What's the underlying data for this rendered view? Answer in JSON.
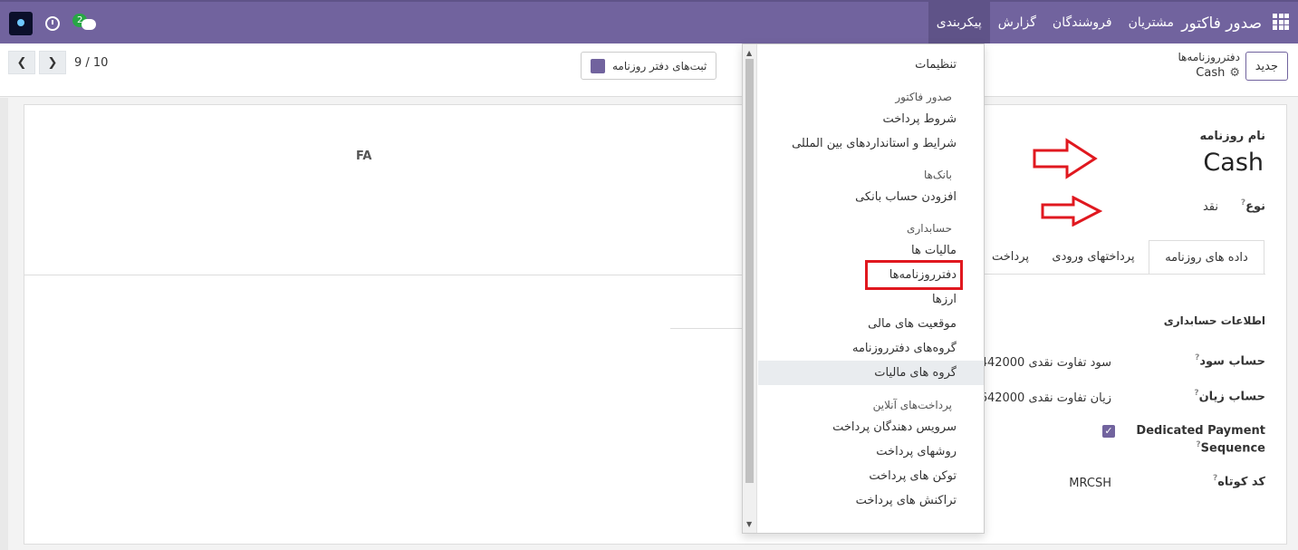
{
  "navbar": {
    "brand": "صدور فاکتور",
    "menu": [
      "مشتریان",
      "فروشندگان",
      "گزارش",
      "پیکربندی"
    ],
    "active_menu": "پیکربندی",
    "chat_badge": "2",
    "color": "#71639e"
  },
  "control": {
    "new_button": "جدید",
    "breadcrumb_parent": "دفترروزنامه‌ها",
    "breadcrumb_current": "Cash",
    "entries_button": "ثبت‌های دفتر روزنامه",
    "pager": "9 / 10"
  },
  "sheet": {
    "fa_text": "FA",
    "journal_name_label": "نام روزنامه",
    "journal_name": "Cash",
    "type_label": "نوع",
    "type_value": "نقد",
    "tabs": [
      "داده های روزنامه",
      "پرداختهای ورودی",
      "پرداخت"
    ],
    "section_title": "اطلاعات حسابداری",
    "profit_label": "حساب سود",
    "profit_value": "442000 سود تفاوت نقدی",
    "loss_label": "حساب زیان",
    "loss_value": "642000 زیان تفاوت نقدی",
    "dedicated_label_1": "Dedicated Payment",
    "dedicated_label_2": "Sequence",
    "dedicated_checked": true,
    "short_code_label": "کد کوتاه",
    "short_code_value": "MRCSH",
    "help_mark": "?"
  },
  "dropdown": {
    "items": [
      {
        "kind": "item",
        "label": "تنظیمات"
      },
      {
        "kind": "header",
        "label": "صدور فاکتور"
      },
      {
        "kind": "item",
        "label": "شروط پرداخت"
      },
      {
        "kind": "item",
        "label": "شرایط و استانداردهای بین المللی"
      },
      {
        "kind": "header",
        "label": "بانک‌ها"
      },
      {
        "kind": "item",
        "label": "افزودن حساب بانکی"
      },
      {
        "kind": "header",
        "label": "حسابداری"
      },
      {
        "kind": "item",
        "label": "مالیات ها"
      },
      {
        "kind": "item",
        "label": "دفترروزنامه‌ها"
      },
      {
        "kind": "item",
        "label": "ارزها"
      },
      {
        "kind": "item",
        "label": "موقعیت های مالی"
      },
      {
        "kind": "item",
        "label": "گروه‌های دفترروزنامه"
      },
      {
        "kind": "item",
        "label": "گروه های مالیات"
      },
      {
        "kind": "header",
        "label": "پرداخت‌های آنلاین"
      },
      {
        "kind": "item",
        "label": "سرویس دهندگان پرداخت"
      },
      {
        "kind": "item",
        "label": "روشهای پرداخت"
      },
      {
        "kind": "item",
        "label": "توکن های پرداخت"
      },
      {
        "kind": "item",
        "label": "تراکنش های پرداخت"
      }
    ],
    "highlighted": "گروه های مالیات",
    "boxed": "دفترروزنامه‌ها"
  }
}
